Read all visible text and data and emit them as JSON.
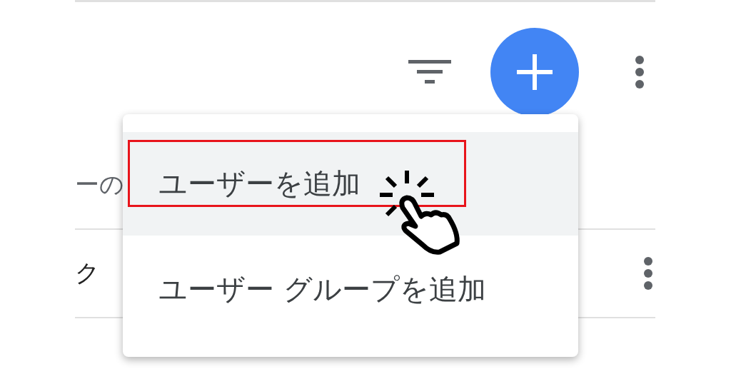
{
  "toolbar": {
    "buttons": [
      {
        "kind": "filter"
      },
      {
        "kind": "add"
      },
      {
        "kind": "more"
      }
    ]
  },
  "rows": [
    {
      "text": "ーの",
      "has_more": false
    },
    {
      "text": "ク",
      "has_more": true
    }
  ],
  "menu": {
    "items": [
      {
        "label": "ユーザーを追加",
        "selected": true,
        "annotated": true
      },
      {
        "label": "ユーザー グループを追加",
        "selected": false,
        "annotated": false
      }
    ]
  }
}
